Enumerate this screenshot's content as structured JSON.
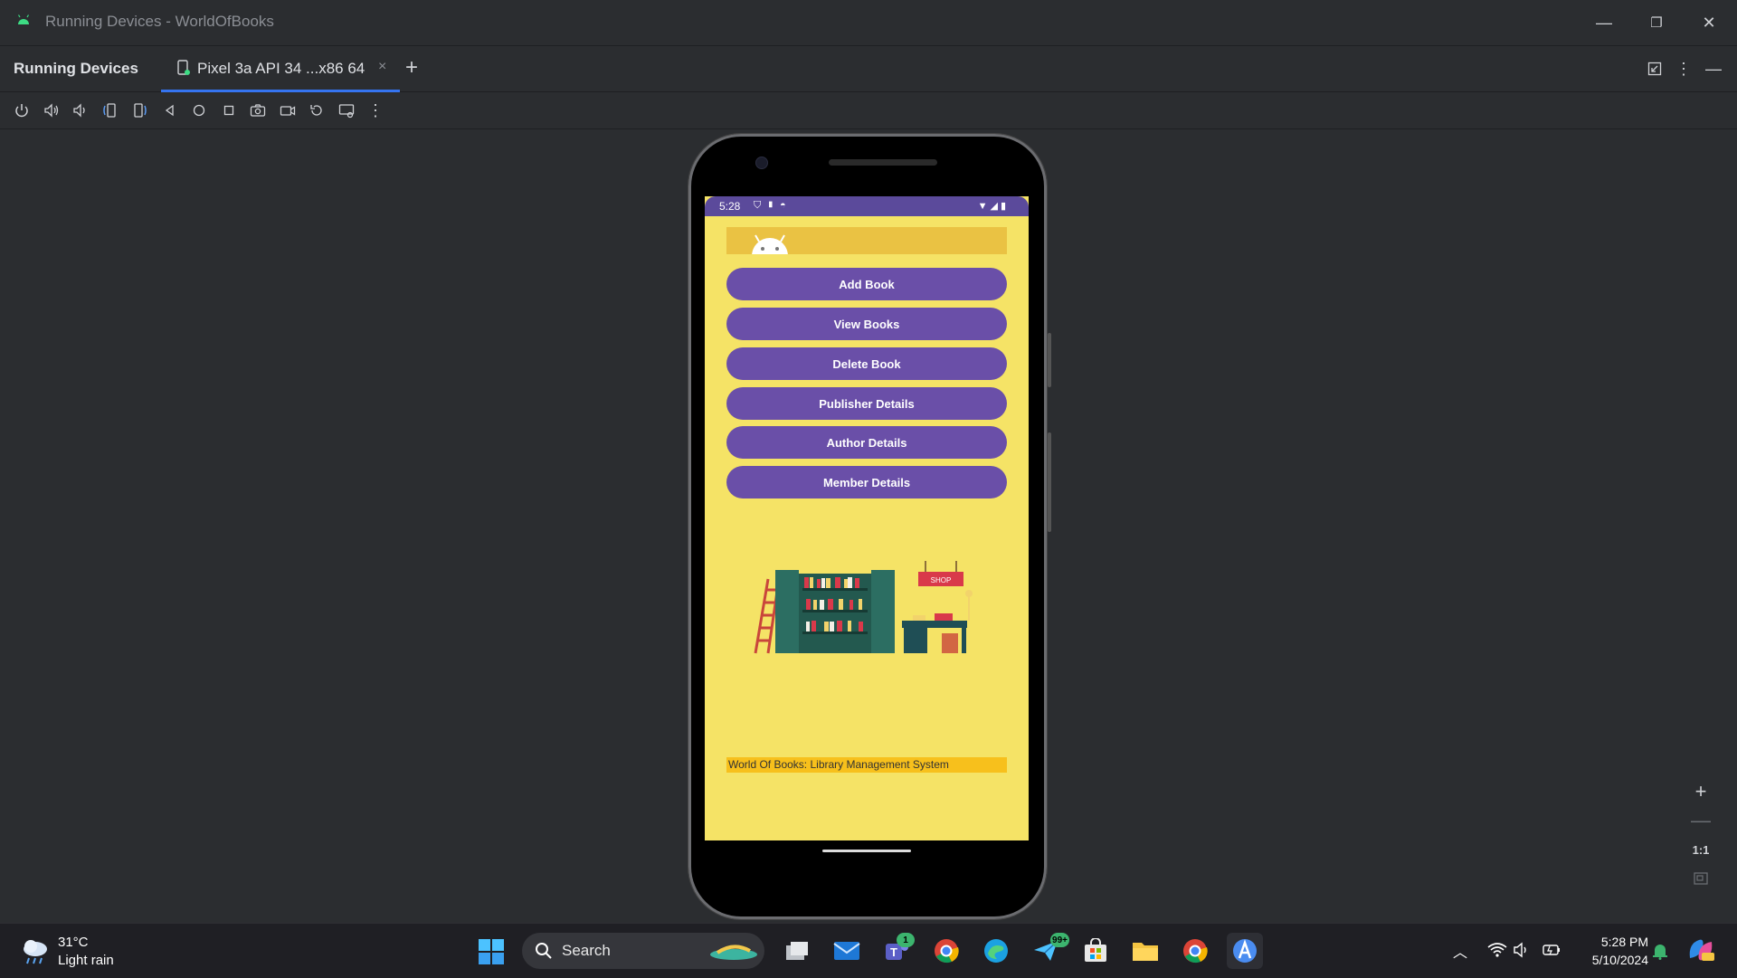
{
  "window": {
    "title": "Running Devices - WorldOfBooks"
  },
  "panel": {
    "title": "Running Devices",
    "tab_label": "Pixel 3a API 34 ...x86 64",
    "tab_close": "×",
    "tab_add": "+"
  },
  "device_toolbar": {
    "icons": [
      "power-icon",
      "volume-up-icon",
      "volume-down-icon",
      "rotate-left-icon",
      "rotate-right-icon",
      "back-icon",
      "home-icon",
      "overview-icon",
      "screenshot-icon",
      "screen-record-icon",
      "reset-icon",
      "device-settings-icon",
      "more-icon"
    ]
  },
  "phone": {
    "status": {
      "time": "5:28"
    },
    "buttons": [
      {
        "label": "Add Book"
      },
      {
        "label": "View Books"
      },
      {
        "label": "Delete Book"
      },
      {
        "label": "Publisher Details"
      },
      {
        "label": "Author Details"
      },
      {
        "label": "Member Details"
      }
    ],
    "footer": "World Of Books: Library Management System",
    "illustration_sign": "SHOP"
  },
  "zoom_controls": {
    "zoom_in": "+",
    "zoom_out": "—",
    "actual_size": "1:1"
  },
  "taskbar": {
    "weather": {
      "temp": "31°C",
      "condition": "Light rain"
    },
    "search_label": "Search",
    "teams_badge": "1",
    "copilot_badge": "99+",
    "clock": {
      "time": "5:28 PM",
      "date": "5/10/2024"
    }
  },
  "colors": {
    "screen_bg": "#f5e366",
    "button_bg": "#6a4fa8",
    "statusbar_bg": "#5b4a9b",
    "appbar_bg": "#eac243",
    "footer_bg": "#f7c01c",
    "tab_underline": "#3574f0"
  }
}
